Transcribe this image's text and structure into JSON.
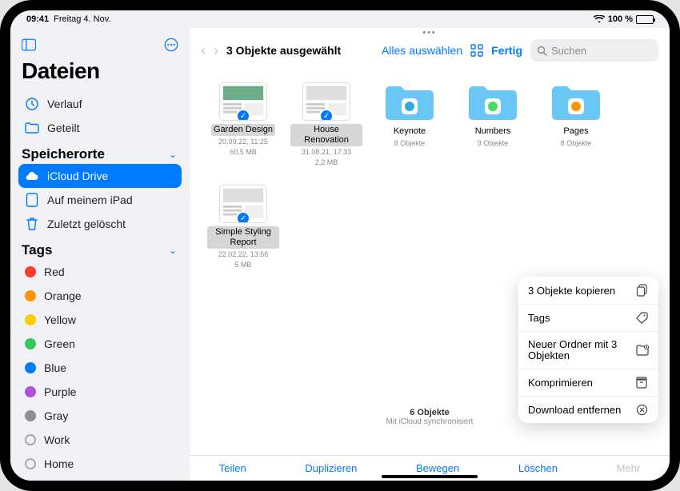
{
  "status": {
    "time": "09:41",
    "date": "Freitag 4. Nov.",
    "battery": "100 %"
  },
  "sidebar": {
    "title": "Dateien",
    "recent": "Verlauf",
    "shared": "Geteilt",
    "locations_title": "Speicherorte",
    "locations": [
      "iCloud Drive",
      "Auf meinem iPad",
      "Zuletzt gelöscht"
    ],
    "tags_title": "Tags",
    "tags": [
      {
        "label": "Red",
        "color": "#ff3b30"
      },
      {
        "label": "Orange",
        "color": "#ff9500"
      },
      {
        "label": "Yellow",
        "color": "#ffcc00"
      },
      {
        "label": "Green",
        "color": "#34c759"
      },
      {
        "label": "Blue",
        "color": "#007aff"
      },
      {
        "label": "Purple",
        "color": "#af52de"
      },
      {
        "label": "Gray",
        "color": "#8e8e93"
      },
      {
        "label": "Work",
        "color": "outline"
      },
      {
        "label": "Home",
        "color": "outline"
      }
    ]
  },
  "topbar": {
    "title": "3 Objekte ausgewählt",
    "select_all": "Alles auswählen",
    "done": "Fertig",
    "search_placeholder": "Suchen"
  },
  "items": [
    {
      "name": "Garden Design",
      "meta1": "20.09.22, 11:25",
      "meta2": "60,5 MB",
      "selected": true,
      "kind": "doc",
      "accent": "#2e8b57"
    },
    {
      "name": "House Renovation",
      "meta1": "31.08.21, 17:33",
      "meta2": "2,2 MB",
      "selected": true,
      "kind": "doc",
      "accent": "#d0d0d0"
    },
    {
      "name": "Keynote",
      "meta1": "8 Objekte",
      "meta2": "",
      "selected": false,
      "kind": "folder",
      "accent": "#34aadc"
    },
    {
      "name": "Numbers",
      "meta1": "9 Objekte",
      "meta2": "",
      "selected": false,
      "kind": "folder",
      "accent": "#4cd964"
    },
    {
      "name": "Pages",
      "meta1": "8 Objekte",
      "meta2": "",
      "selected": false,
      "kind": "folder",
      "accent": "#ff9500"
    },
    {
      "name": "Simple Styling Report",
      "meta1": "22.02.22, 13:56",
      "meta2": "5 MB",
      "selected": true,
      "kind": "doc",
      "accent": "#d0d0d0"
    }
  ],
  "footer": {
    "count": "6 Objekte",
    "sync": "Mit iCloud synchronisiert"
  },
  "toolbar": {
    "share": "Teilen",
    "duplicate": "Duplizieren",
    "move": "Bewegen",
    "delete": "Löschen",
    "more": "Mehr"
  },
  "popover": {
    "copy": "3 Objekte kopieren",
    "tags": "Tags",
    "newfolder": "Neuer Ordner mit 3 Objekten",
    "compress": "Komprimieren",
    "remove_download": "Download entfernen"
  }
}
